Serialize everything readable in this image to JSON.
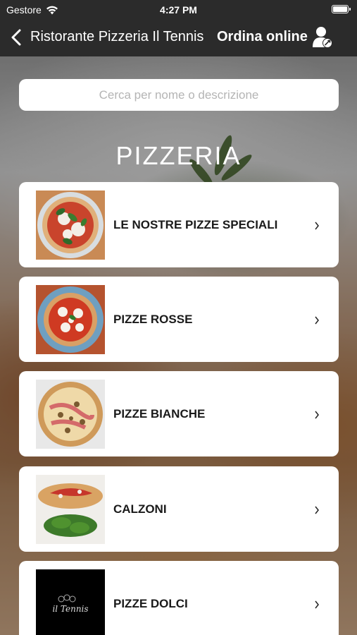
{
  "status": {
    "carrier": "Gestore",
    "time": "4:27 PM"
  },
  "nav": {
    "title": "Ristorante Pizzeria Il Tennis",
    "right_label": "Ordina online"
  },
  "search": {
    "placeholder": "Cerca per nome o descrizione"
  },
  "section": {
    "title": "PIZZERIA"
  },
  "categories": [
    {
      "label": "LE NOSTRE PIZZE SPECIALI",
      "icon": "special-pizza-photo"
    },
    {
      "label": "PIZZE ROSSE",
      "icon": "margherita-pizza-photo"
    },
    {
      "label": "PIZZE BIANCHE",
      "icon": "white-pizza-photo"
    },
    {
      "label": "CALZONI",
      "icon": "calzone-photo"
    },
    {
      "label": "PIZZE DOLCI",
      "icon": "il-tennis-logo"
    }
  ],
  "logo_text": "il Tennis",
  "colors": {
    "bar": "#2b2b2b",
    "card": "#ffffff",
    "text": "#1a1a1a"
  }
}
